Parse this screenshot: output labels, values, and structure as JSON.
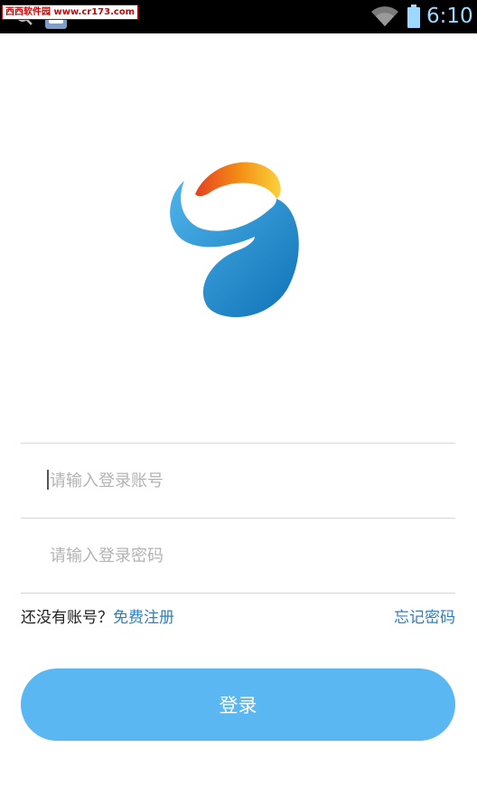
{
  "status_bar": {
    "watermark_text": "西西软件园 www.cr173.com",
    "time": "6:10",
    "icons": [
      "search-icon",
      "baidu-icon",
      "wifi-icon",
      "battery-icon"
    ]
  },
  "login": {
    "logo_icon": "app-logo",
    "account_placeholder": "请输入登录账号",
    "password_placeholder": "请输入登录密码",
    "no_account_text": "还没有账号？",
    "register_label": "免费注册",
    "forgot_password_label": "忘记密码",
    "login_button_label": "登录"
  },
  "colors": {
    "accent": "#5bb7f1",
    "link": "#2f7fc0",
    "status_bar": "#000000"
  }
}
